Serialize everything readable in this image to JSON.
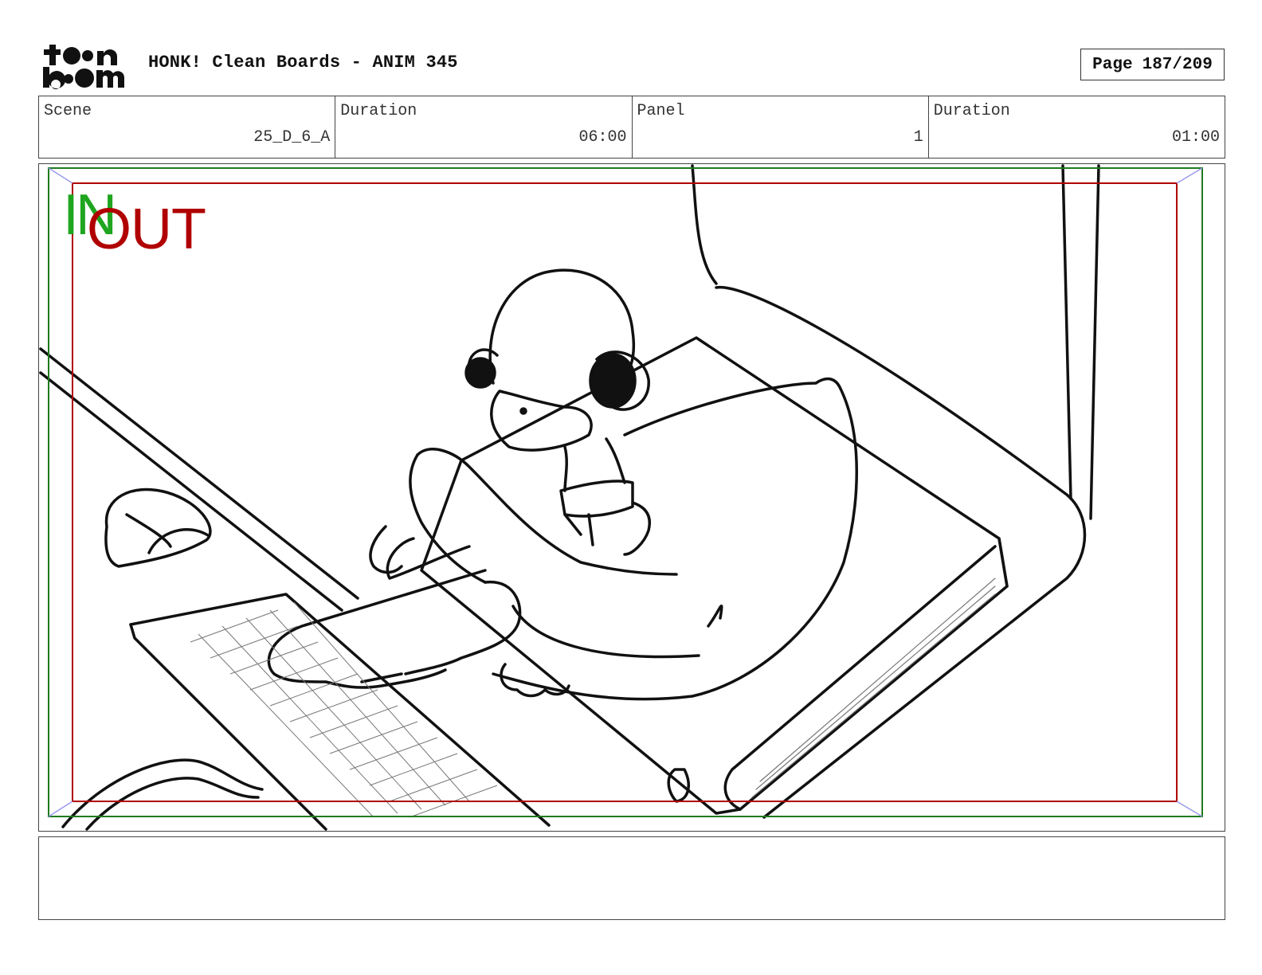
{
  "header": {
    "logo_text": "toon boom",
    "title": "HONK! Clean Boards - ANIM 345",
    "page_label": "Page",
    "page_value": "187/209"
  },
  "info": [
    {
      "label": "Scene",
      "value": "25_D_6_A"
    },
    {
      "label": "Duration",
      "value": "06:00"
    },
    {
      "label": "Panel",
      "value": "1"
    },
    {
      "label": "Duration",
      "value": "01:00"
    }
  ],
  "panel": {
    "in_label": "IN",
    "out_label": "OUT",
    "colors": {
      "in_frame": "#1f7a1f",
      "out_frame": "#b00000",
      "in_text": "#1fa51f",
      "out_text": "#b00000"
    }
  },
  "notes": {
    "text": ""
  }
}
